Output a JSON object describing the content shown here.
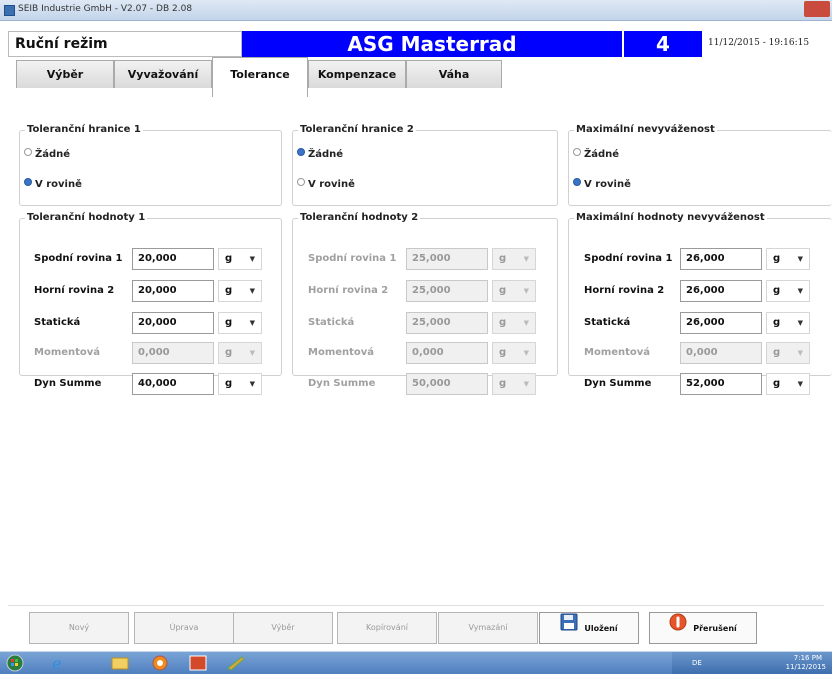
{
  "window": {
    "title": "SEIB Industrie GmbH - V2.07 - DB 2.08"
  },
  "header": {
    "mode": "Ruční režim",
    "machine": "ASG Masterrad",
    "number": "4",
    "datetime": "11/12/2015 - 19:16:15",
    "accent_color": "#0000ff"
  },
  "tabs": [
    {
      "label": "Výběr"
    },
    {
      "label": "Vyvažování"
    },
    {
      "label": "Tolerance",
      "active": true
    },
    {
      "label": "Kompenzace"
    },
    {
      "label": "Váha"
    }
  ],
  "tolerance_limits": [
    {
      "title": "Toleranční hranice 1",
      "options": [
        {
          "label": "Žádné",
          "selected": false
        },
        {
          "label": "V rovině",
          "selected": true
        }
      ]
    },
    {
      "title": "Toleranční hranice 2",
      "options": [
        {
          "label": "Žádné",
          "selected": true
        },
        {
          "label": "V rovině",
          "selected": false
        }
      ]
    },
    {
      "title": "Maximální nevyváženost",
      "options": [
        {
          "label": "Žádné",
          "selected": false
        },
        {
          "label": "V rovině",
          "selected": true
        }
      ]
    }
  ],
  "tolerance_values": [
    {
      "title": "Toleranční hodnoty 1",
      "rows": [
        {
          "label": "Spodní rovina 1",
          "value": "20,000",
          "unit": "g",
          "enabled": true
        },
        {
          "label": "Horní rovina 2",
          "value": "20,000",
          "unit": "g",
          "enabled": true
        },
        {
          "label": "Statická",
          "value": "20,000",
          "unit": "g",
          "enabled": true
        },
        {
          "label": "Momentová",
          "value": "0,000",
          "unit": "g",
          "enabled": false
        },
        {
          "label": "Dyn Summe",
          "value": "40,000",
          "unit": "g",
          "enabled": true
        }
      ]
    },
    {
      "title": "Toleranční hodnoty 2",
      "rows": [
        {
          "label": "Spodní rovina 1",
          "value": "25,000",
          "unit": "g",
          "enabled": false
        },
        {
          "label": "Horní rovina 2",
          "value": "25,000",
          "unit": "g",
          "enabled": false
        },
        {
          "label": "Statická",
          "value": "25,000",
          "unit": "g",
          "enabled": false
        },
        {
          "label": "Momentová",
          "value": "0,000",
          "unit": "g",
          "enabled": false
        },
        {
          "label": "Dyn Summe",
          "value": "50,000",
          "unit": "g",
          "enabled": false
        }
      ]
    },
    {
      "title": "Maximální hodnoty nevyváženost",
      "rows": [
        {
          "label": "Spodní rovina 1",
          "value": "26,000",
          "unit": "g",
          "enabled": true
        },
        {
          "label": "Horní rovina 2",
          "value": "26,000",
          "unit": "g",
          "enabled": true
        },
        {
          "label": "Statická",
          "value": "26,000",
          "unit": "g",
          "enabled": true
        },
        {
          "label": "Momentová",
          "value": "0,000",
          "unit": "g",
          "enabled": false
        },
        {
          "label": "Dyn Summe",
          "value": "52,000",
          "unit": "g",
          "enabled": true
        }
      ]
    }
  ],
  "bottom_buttons": [
    {
      "label": "Nový",
      "enabled": false
    },
    {
      "label": "Úprava",
      "enabled": false
    },
    {
      "label": "Výběr",
      "enabled": false
    },
    {
      "label": "Kopírování",
      "enabled": false
    },
    {
      "label": "Vymazání",
      "enabled": false
    },
    {
      "label": "Uložení",
      "enabled": true,
      "icon": "floppy-disk-icon"
    },
    {
      "label": "Přerušení",
      "enabled": true,
      "icon": "stop-icon"
    }
  ],
  "taskbar": {
    "language": "DE",
    "time": "7:16 PM",
    "date": "11/12/2015",
    "icons": [
      "start-orb-icon",
      "internet-explorer-icon",
      "folder-icon",
      "media-player-icon",
      "app-icon",
      "paint-icon"
    ]
  }
}
